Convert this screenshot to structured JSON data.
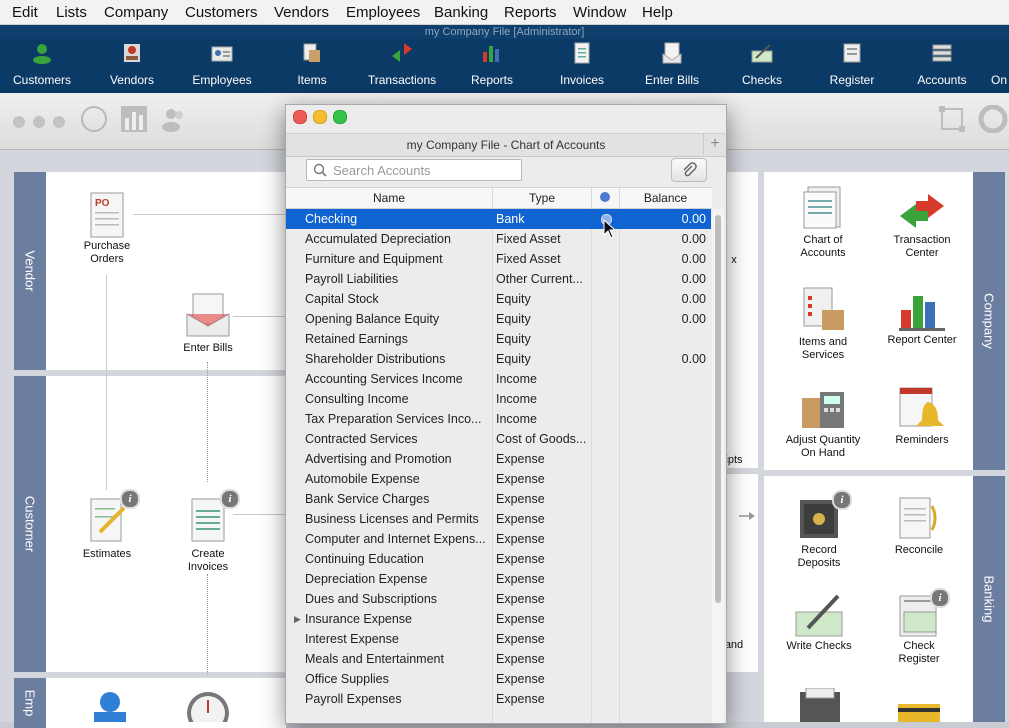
{
  "menu": [
    "Edit",
    "Lists",
    "Company",
    "Customers",
    "Vendors",
    "Employees",
    "Banking",
    "Reports",
    "Window",
    "Help"
  ],
  "window_title": "my Company File [Administrator]",
  "toolbar": [
    {
      "label": "Customers",
      "icon": "customers-icon"
    },
    {
      "label": "Vendors",
      "icon": "vendors-icon"
    },
    {
      "label": "Employees",
      "icon": "employees-icon"
    },
    {
      "label": "Items",
      "icon": "items-icon"
    },
    {
      "label": "Transactions",
      "icon": "transactions-icon"
    },
    {
      "label": "Reports",
      "icon": "reports-icon"
    },
    {
      "label": "Invoices",
      "icon": "invoices-icon"
    },
    {
      "label": "Enter Bills",
      "icon": "enter-bills-icon"
    },
    {
      "label": "Checks",
      "icon": "checks-icon"
    },
    {
      "label": "Register",
      "icon": "register-icon"
    },
    {
      "label": "Accounts",
      "icon": "accounts-icon"
    },
    {
      "label": "On",
      "icon": "online-icon"
    }
  ],
  "home": {
    "tabs": {
      "vendor": "Vendor",
      "customer": "Customer",
      "employees": "Emp",
      "company": "Company",
      "banking": "Banking"
    },
    "vendor_items": {
      "purchase_orders": "Purchase Orders",
      "enter_bills": "Enter Bills"
    },
    "customer_items": {
      "estimates": "Estimates",
      "create_invoices": "Create Invoices"
    },
    "partial": {
      "x": "x",
      "ipts": "ipts",
      "and": "and"
    },
    "company_items": {
      "chart_of_accounts": "Chart of Accounts",
      "transaction_center": "Transaction Center",
      "items_and_services": "Items and Services",
      "report_center": "Report Center",
      "adjust_quantity": "Adjust Quantity On Hand",
      "reminders": "Reminders"
    },
    "banking_items": {
      "record_deposits": "Record Deposits",
      "reconcile": "Reconcile",
      "write_checks": "Write Checks",
      "check_register": "Check Register"
    }
  },
  "coa": {
    "title": "my Company File - Chart of Accounts",
    "search_placeholder": "Search Accounts",
    "columns": {
      "name": "Name",
      "type": "Type",
      "balance": "Balance"
    },
    "rows": [
      {
        "name": "Checking",
        "type": "Bank",
        "balance": "0.00",
        "selected": true
      },
      {
        "name": "Accumulated Depreciation",
        "type": "Fixed Asset",
        "balance": "0.00"
      },
      {
        "name": "Furniture and Equipment",
        "type": "Fixed Asset",
        "balance": "0.00"
      },
      {
        "name": "Payroll Liabilities",
        "type": "Other Current...",
        "balance": "0.00"
      },
      {
        "name": "Capital Stock",
        "type": "Equity",
        "balance": "0.00"
      },
      {
        "name": "Opening Balance Equity",
        "type": "Equity",
        "balance": "0.00"
      },
      {
        "name": "Retained Earnings",
        "type": "Equity",
        "balance": ""
      },
      {
        "name": "Shareholder Distributions",
        "type": "Equity",
        "balance": "0.00"
      },
      {
        "name": "Accounting Services Income",
        "type": "Income",
        "balance": ""
      },
      {
        "name": "Consulting Income",
        "type": "Income",
        "balance": ""
      },
      {
        "name": "Tax Preparation Services Inco...",
        "type": "Income",
        "balance": ""
      },
      {
        "name": "Contracted Services",
        "type": "Cost of Goods...",
        "balance": ""
      },
      {
        "name": "Advertising and Promotion",
        "type": "Expense",
        "balance": ""
      },
      {
        "name": "Automobile Expense",
        "type": "Expense",
        "balance": ""
      },
      {
        "name": "Bank Service Charges",
        "type": "Expense",
        "balance": ""
      },
      {
        "name": "Business Licenses and Permits",
        "type": "Expense",
        "balance": ""
      },
      {
        "name": "Computer and Internet Expens...",
        "type": "Expense",
        "balance": ""
      },
      {
        "name": "Continuing Education",
        "type": "Expense",
        "balance": ""
      },
      {
        "name": "Depreciation Expense",
        "type": "Expense",
        "balance": ""
      },
      {
        "name": "Dues and Subscriptions",
        "type": "Expense",
        "balance": ""
      },
      {
        "name": "Insurance Expense",
        "type": "Expense",
        "balance": "",
        "expandable": true
      },
      {
        "name": "Interest Expense",
        "type": "Expense",
        "balance": ""
      },
      {
        "name": "Meals and Entertainment",
        "type": "Expense",
        "balance": ""
      },
      {
        "name": "Office Supplies",
        "type": "Expense",
        "balance": ""
      },
      {
        "name": "Payroll Expenses",
        "type": "Expense",
        "balance": ""
      }
    ]
  },
  "colors": {
    "accent": "#0f64d2",
    "toolbar": "#0c3a66",
    "sidetab": "#6c7ea0"
  }
}
